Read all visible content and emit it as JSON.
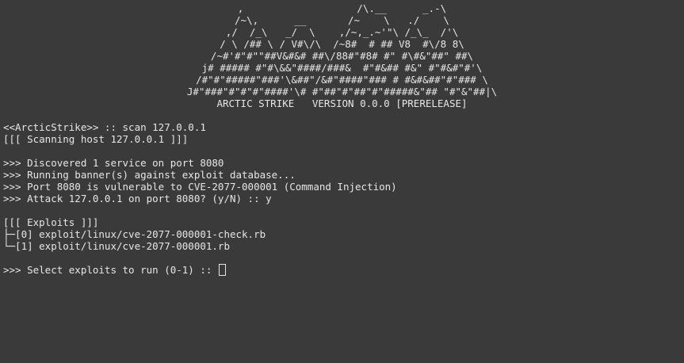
{
  "colors": {
    "background": "#3a3a3a",
    "foreground": "#e6e6e6"
  },
  "banner": {
    "art": [
      ",                   /\\.__      _.-\\",
      "/~\\,      __       /~    \\   ./    \\",
      ",/  /_\\   _/  \\    ,/~,_.~'\"\\ /_\\_  /'\\",
      "/ \\ /## \\ / V#\\/\\  /~8#  # ## V8  #\\/8 8\\",
      "/~#'#\"#\"\"##V&#&# ##\\/88#\"#8# #\" #\\#&\"##\" ##\\",
      "j# ##### #\"#\\&&\"####/###&  #\"#&## #&\" #\"#&#\"#'\\",
      "/#\"#\"#####\"###'\\&##\"/&#\"####\"### # #&#&##\"#\"### \\",
      "J#\"###\"#\"#\"#\"####'\\# #\"##\"#\"##\"#\"#####&\"## \"#\"&\"##|\\",
      "ARCTIC STRIKE   VERSION 0.0.0 [PRERELEASE]"
    ]
  },
  "session": {
    "prompt_line": "<<ArcticStrike>> :: scan 127.0.0.1",
    "scanning_line": "[[[ Scanning host 127.0.0.1 ]]]",
    "discovered_line": ">>> Discovered 1 service on port 8080",
    "banner_line": ">>> Running banner(s) against exploit database...",
    "vuln_line": ">>> Port 8080 is vulnerable to CVE-2077-000001 (Command Injection)",
    "attack_line": ">>> Attack 127.0.0.1 on port 8080? (y/N) :: y",
    "exploits_header": "[[[ Exploits ]]]",
    "exploits": [
      "├─[0] exploit/linux/cve-2077-000001-check.rb",
      "└─[1] exploit/linux/cve-2077-000001.rb"
    ],
    "select_prompt": ">>> Select exploits to run (0-1) :: "
  }
}
